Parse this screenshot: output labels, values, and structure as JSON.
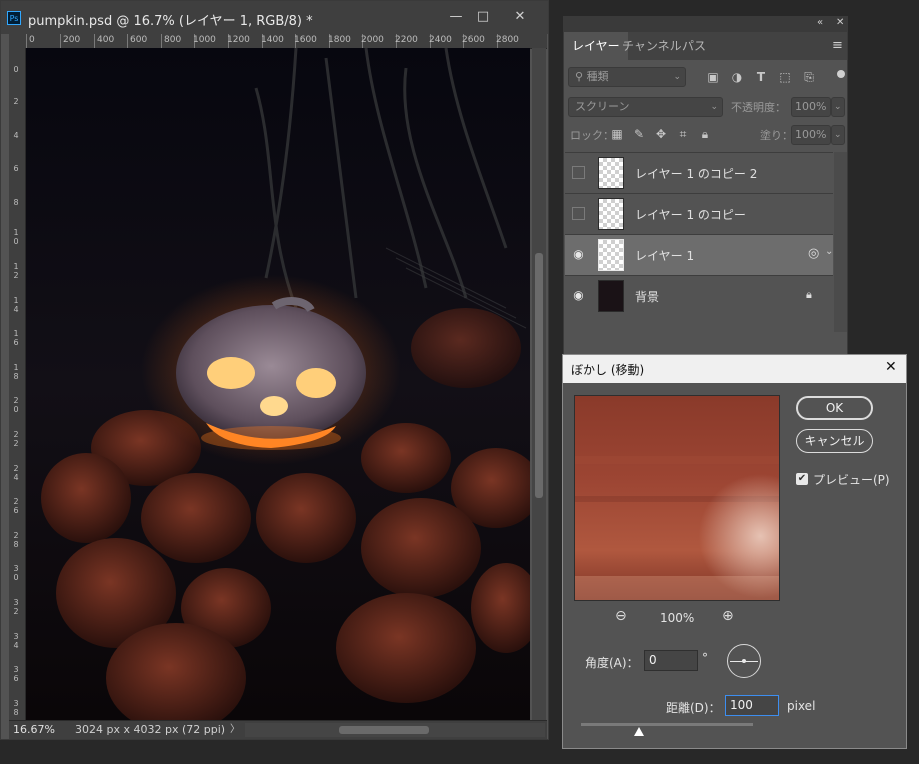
{
  "document": {
    "title": "pumpkin.psd @ 16.7% (レイヤー 1, RGB/8) *",
    "app_icon": "Ps",
    "window_buttons": {
      "minimize": "—",
      "restore": "□",
      "close": "✕"
    },
    "ruler_top": [
      "0",
      "200",
      "400",
      "600",
      "800",
      "1000",
      "1200",
      "1400",
      "1600",
      "1800",
      "2000",
      "2200",
      "2400",
      "2600",
      "2800"
    ],
    "ruler_left": [
      "0",
      "2",
      "4",
      "6",
      "8",
      "1 0",
      "1 2",
      "1 4",
      "1 6",
      "1 8",
      "2 0",
      "2 2",
      "2 4",
      "2 6",
      "2 8",
      "3 0",
      "3 2",
      "3 4",
      "3 6",
      "3 8"
    ],
    "zoom": "16.67%",
    "info": "3024 px x 4032 px (72 ppi)",
    "status_arrow": "〉"
  },
  "layers_panel": {
    "collapse_icon": "«",
    "close_icon": "✕",
    "tabs": [
      {
        "label": "レイヤー",
        "active": true
      },
      {
        "label": "チャンネル",
        "active": false
      },
      {
        "label": "パス",
        "active": false
      }
    ],
    "menu_icon": "≡",
    "filter_kind": "種類",
    "blend_mode": "スクリーン",
    "opacity_label": "不透明度：",
    "opacity_value": "100%",
    "lock_label": "ロック：",
    "fill_label": "塗り：",
    "fill_value": "100%",
    "layers": [
      {
        "name": "レイヤー 1 のコピー 2",
        "visible": false,
        "selected": false,
        "kind": "pixel"
      },
      {
        "name": "レイヤー 1 のコピー",
        "visible": false,
        "selected": false,
        "kind": "pixel"
      },
      {
        "name": "レイヤー 1",
        "visible": true,
        "selected": true,
        "kind": "pixel"
      },
      {
        "name": "背景",
        "visible": true,
        "selected": false,
        "kind": "background",
        "locked": true
      }
    ]
  },
  "dialog": {
    "title": "ぼかし (移動)",
    "ok_label": "OK",
    "cancel_label": "キャンセル",
    "preview_checked": true,
    "preview_label": "プレビュー(P)",
    "zoom_value": "100%",
    "zoom_out_icon": "⊖",
    "zoom_in_icon": "⊕",
    "angle_label": "角度(A)：",
    "angle_value": "0",
    "angle_unit": "°",
    "distance_label": "距離(D)：",
    "distance_value": "100",
    "distance_unit": "pixel",
    "distance_slider_fraction": 0.1
  },
  "colors": {
    "panel": "#535353",
    "app_bg": "#282828",
    "selection": "#6d6d6d",
    "accent": "#31a8ff"
  }
}
